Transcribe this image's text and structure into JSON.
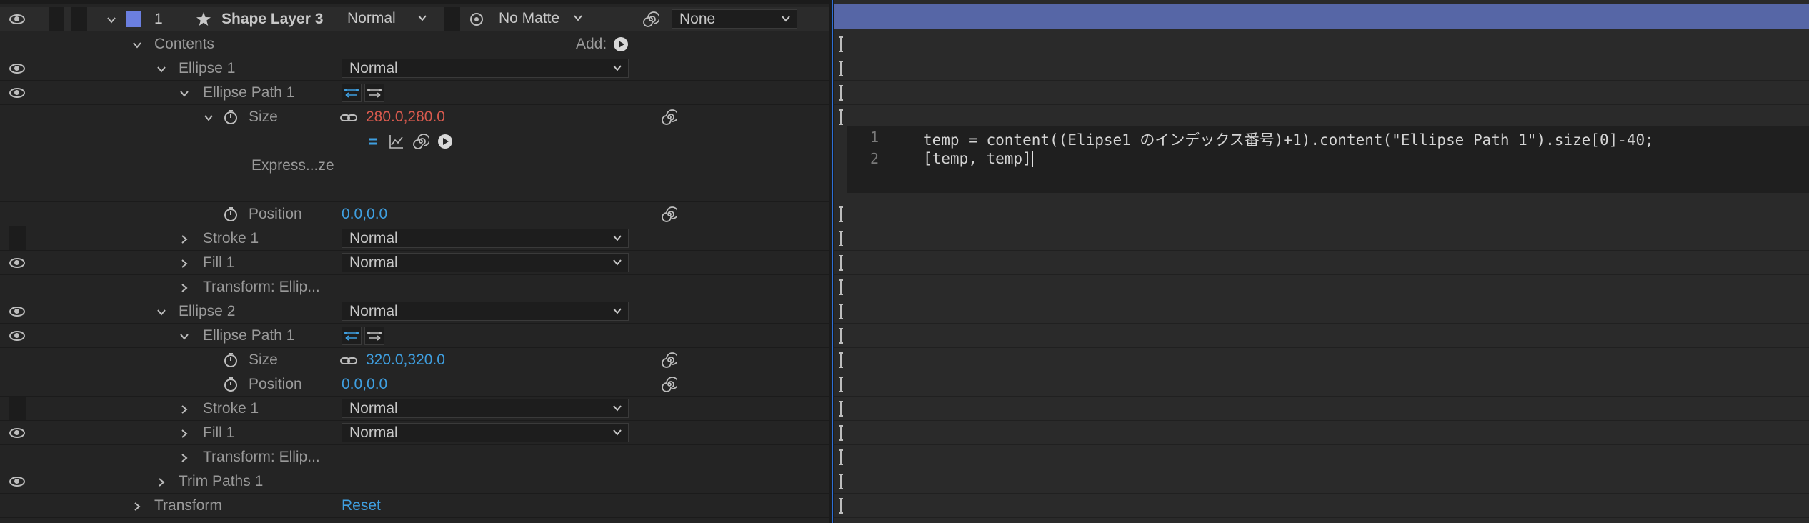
{
  "layer": {
    "number": "1",
    "name": "Shape Layer 3",
    "mode": "Normal",
    "matte": "No Matte",
    "parent": "None"
  },
  "contents": {
    "label": "Contents",
    "add_label": "Add:"
  },
  "ellipse1": {
    "label": "Ellipse 1",
    "mode": "Normal",
    "path_label": "Ellipse Path 1",
    "size_label": "Size",
    "size_value_a": "280.0",
    "size_value_b": "280.0",
    "expr_label": "Express...ze",
    "position_label": "Position",
    "position_value": "0.0,0.0",
    "stroke_label": "Stroke 1",
    "stroke_mode": "Normal",
    "fill_label": "Fill 1",
    "fill_mode": "Normal",
    "transform_label": "Transform: Ellip..."
  },
  "ellipse2": {
    "label": "Ellipse 2",
    "mode": "Normal",
    "path_label": "Ellipse Path 1",
    "size_label": "Size",
    "size_value": "320.0,320.0",
    "position_label": "Position",
    "position_value": "0.0,0.0",
    "stroke_label": "Stroke 1",
    "stroke_mode": "Normal",
    "fill_label": "Fill 1",
    "fill_mode": "Normal",
    "transform_label": "Transform: Ellip..."
  },
  "trim": {
    "label": "Trim Paths 1"
  },
  "transform": {
    "label": "Transform",
    "reset_label": "Reset"
  },
  "editor": {
    "line1_no": "1",
    "line2_no": "2",
    "line1_code": "temp = content((Elipse1 のインデックス番号)+1).content(\"Ellipse Path 1\").size[0]-40;",
    "line2_code": "[temp, temp]"
  },
  "colors": {
    "layer_label": "#6b7fe0",
    "timeline_bar": "#5666a6",
    "keyword": "#e8c47a",
    "number": "#55c3e6",
    "string": "#e57373",
    "value_red": "#d85a4e",
    "value_blue": "#3f9fe0"
  },
  "icons": [
    "eye-icon",
    "chevron-down-icon",
    "chevron-right-icon",
    "star-icon",
    "spiral-icon",
    "stopwatch-icon",
    "chain-icon",
    "play-icon",
    "graph-icon",
    "equals-icon"
  ]
}
